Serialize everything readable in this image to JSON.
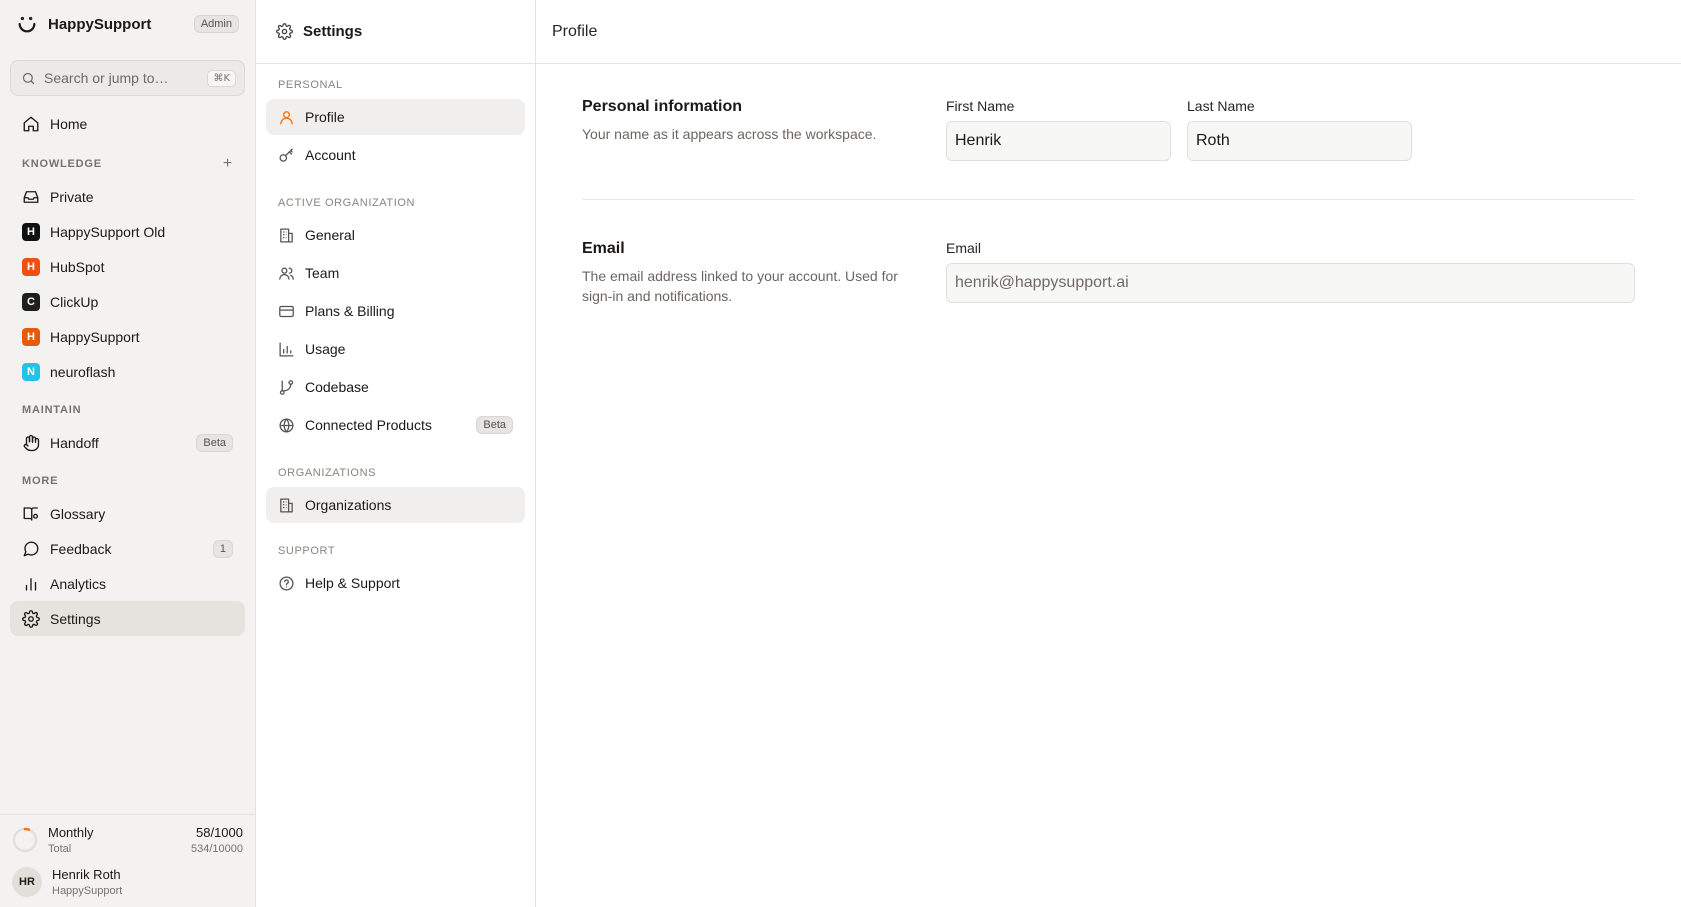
{
  "sidebar": {
    "brand": "HappySupport",
    "role_badge": "Admin",
    "search_placeholder": "Search or jump to…",
    "search_shortcut": "⌘K",
    "home_label": "Home",
    "knowledge_title": "KNOWLEDGE",
    "knowledge_items": [
      {
        "label": "Private"
      },
      {
        "label": "HappySupport Old",
        "initial": "H",
        "color": "#111111"
      },
      {
        "label": "HubSpot",
        "initial": "H",
        "color": "#f0500f"
      },
      {
        "label": "ClickUp",
        "initial": "C",
        "color": "#1f1f1f"
      },
      {
        "label": "HappySupport",
        "initial": "H",
        "color": "#ea580c"
      },
      {
        "label": "neuroflash",
        "initial": "N",
        "color": "#22c3e6"
      }
    ],
    "maintain_title": "MAINTAIN",
    "handoff_label": "Handoff",
    "handoff_badge": "Beta",
    "more_title": "MORE",
    "glossary_label": "Glossary",
    "feedback_label": "Feedback",
    "feedback_count": "1",
    "analytics_label": "Analytics",
    "settings_label": "Settings",
    "usage": {
      "title": "Monthly",
      "value": "58/1000",
      "sub": "Total",
      "total": "534/10000",
      "fraction": 0.058
    },
    "user": {
      "initials": "HR",
      "name": "Henrik Roth",
      "org": "HappySupport"
    }
  },
  "settings_nav": {
    "title": "Settings",
    "personal_title": "PERSONAL",
    "profile_label": "Profile",
    "account_label": "Account",
    "active_org_title": "ACTIVE ORGANIZATION",
    "general_label": "General",
    "team_label": "Team",
    "plans_label": "Plans & Billing",
    "usage_label": "Usage",
    "codebase_label": "Codebase",
    "connected_label": "Connected Products",
    "connected_badge": "Beta",
    "orgs_title": "ORGANIZATIONS",
    "orgs_label": "Organizations",
    "support_title": "SUPPORT",
    "help_label": "Help & Support"
  },
  "main": {
    "title": "Profile",
    "personal": {
      "heading": "Personal information",
      "description": "Your name as it appears across the workspace.",
      "first_name_label": "First Name",
      "first_name_value": "Henrik",
      "last_name_label": "Last Name",
      "last_name_value": "Roth"
    },
    "email": {
      "heading": "Email",
      "description": "The email address linked to your account. Used for sign-in and notifications.",
      "label": "Email",
      "value": "henrik@happysupport.ai"
    }
  },
  "colors": {
    "accent": "#f97316",
    "sidebar_bg": "#f4f2f0"
  }
}
